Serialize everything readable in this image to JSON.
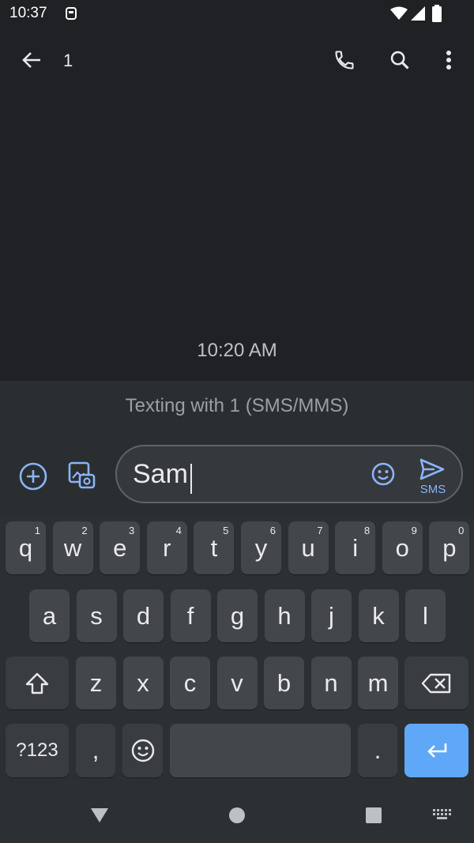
{
  "status_bar": {
    "time": "10:37"
  },
  "app_bar": {
    "title": "1"
  },
  "thread": {
    "timestamp": "10:20 AM",
    "banner": "Texting with 1 (SMS/MMS)"
  },
  "compose": {
    "message": "Sam",
    "send_label": "SMS"
  },
  "keyboard": {
    "row1": [
      {
        "label": "q",
        "hint": "1"
      },
      {
        "label": "w",
        "hint": "2"
      },
      {
        "label": "e",
        "hint": "3"
      },
      {
        "label": "r",
        "hint": "4"
      },
      {
        "label": "t",
        "hint": "5"
      },
      {
        "label": "y",
        "hint": "6"
      },
      {
        "label": "u",
        "hint": "7"
      },
      {
        "label": "i",
        "hint": "8"
      },
      {
        "label": "o",
        "hint": "9"
      },
      {
        "label": "p",
        "hint": "0"
      }
    ],
    "row2": [
      "a",
      "s",
      "d",
      "f",
      "g",
      "h",
      "j",
      "k",
      "l"
    ],
    "row3": [
      "z",
      "x",
      "c",
      "v",
      "b",
      "n",
      "m"
    ],
    "symbols_label": "?123",
    "comma_label": ",",
    "period_label": "."
  },
  "colors": {
    "accent": "#8ab4f8",
    "enter_key": "#5ea8f7",
    "background": "#202124"
  }
}
